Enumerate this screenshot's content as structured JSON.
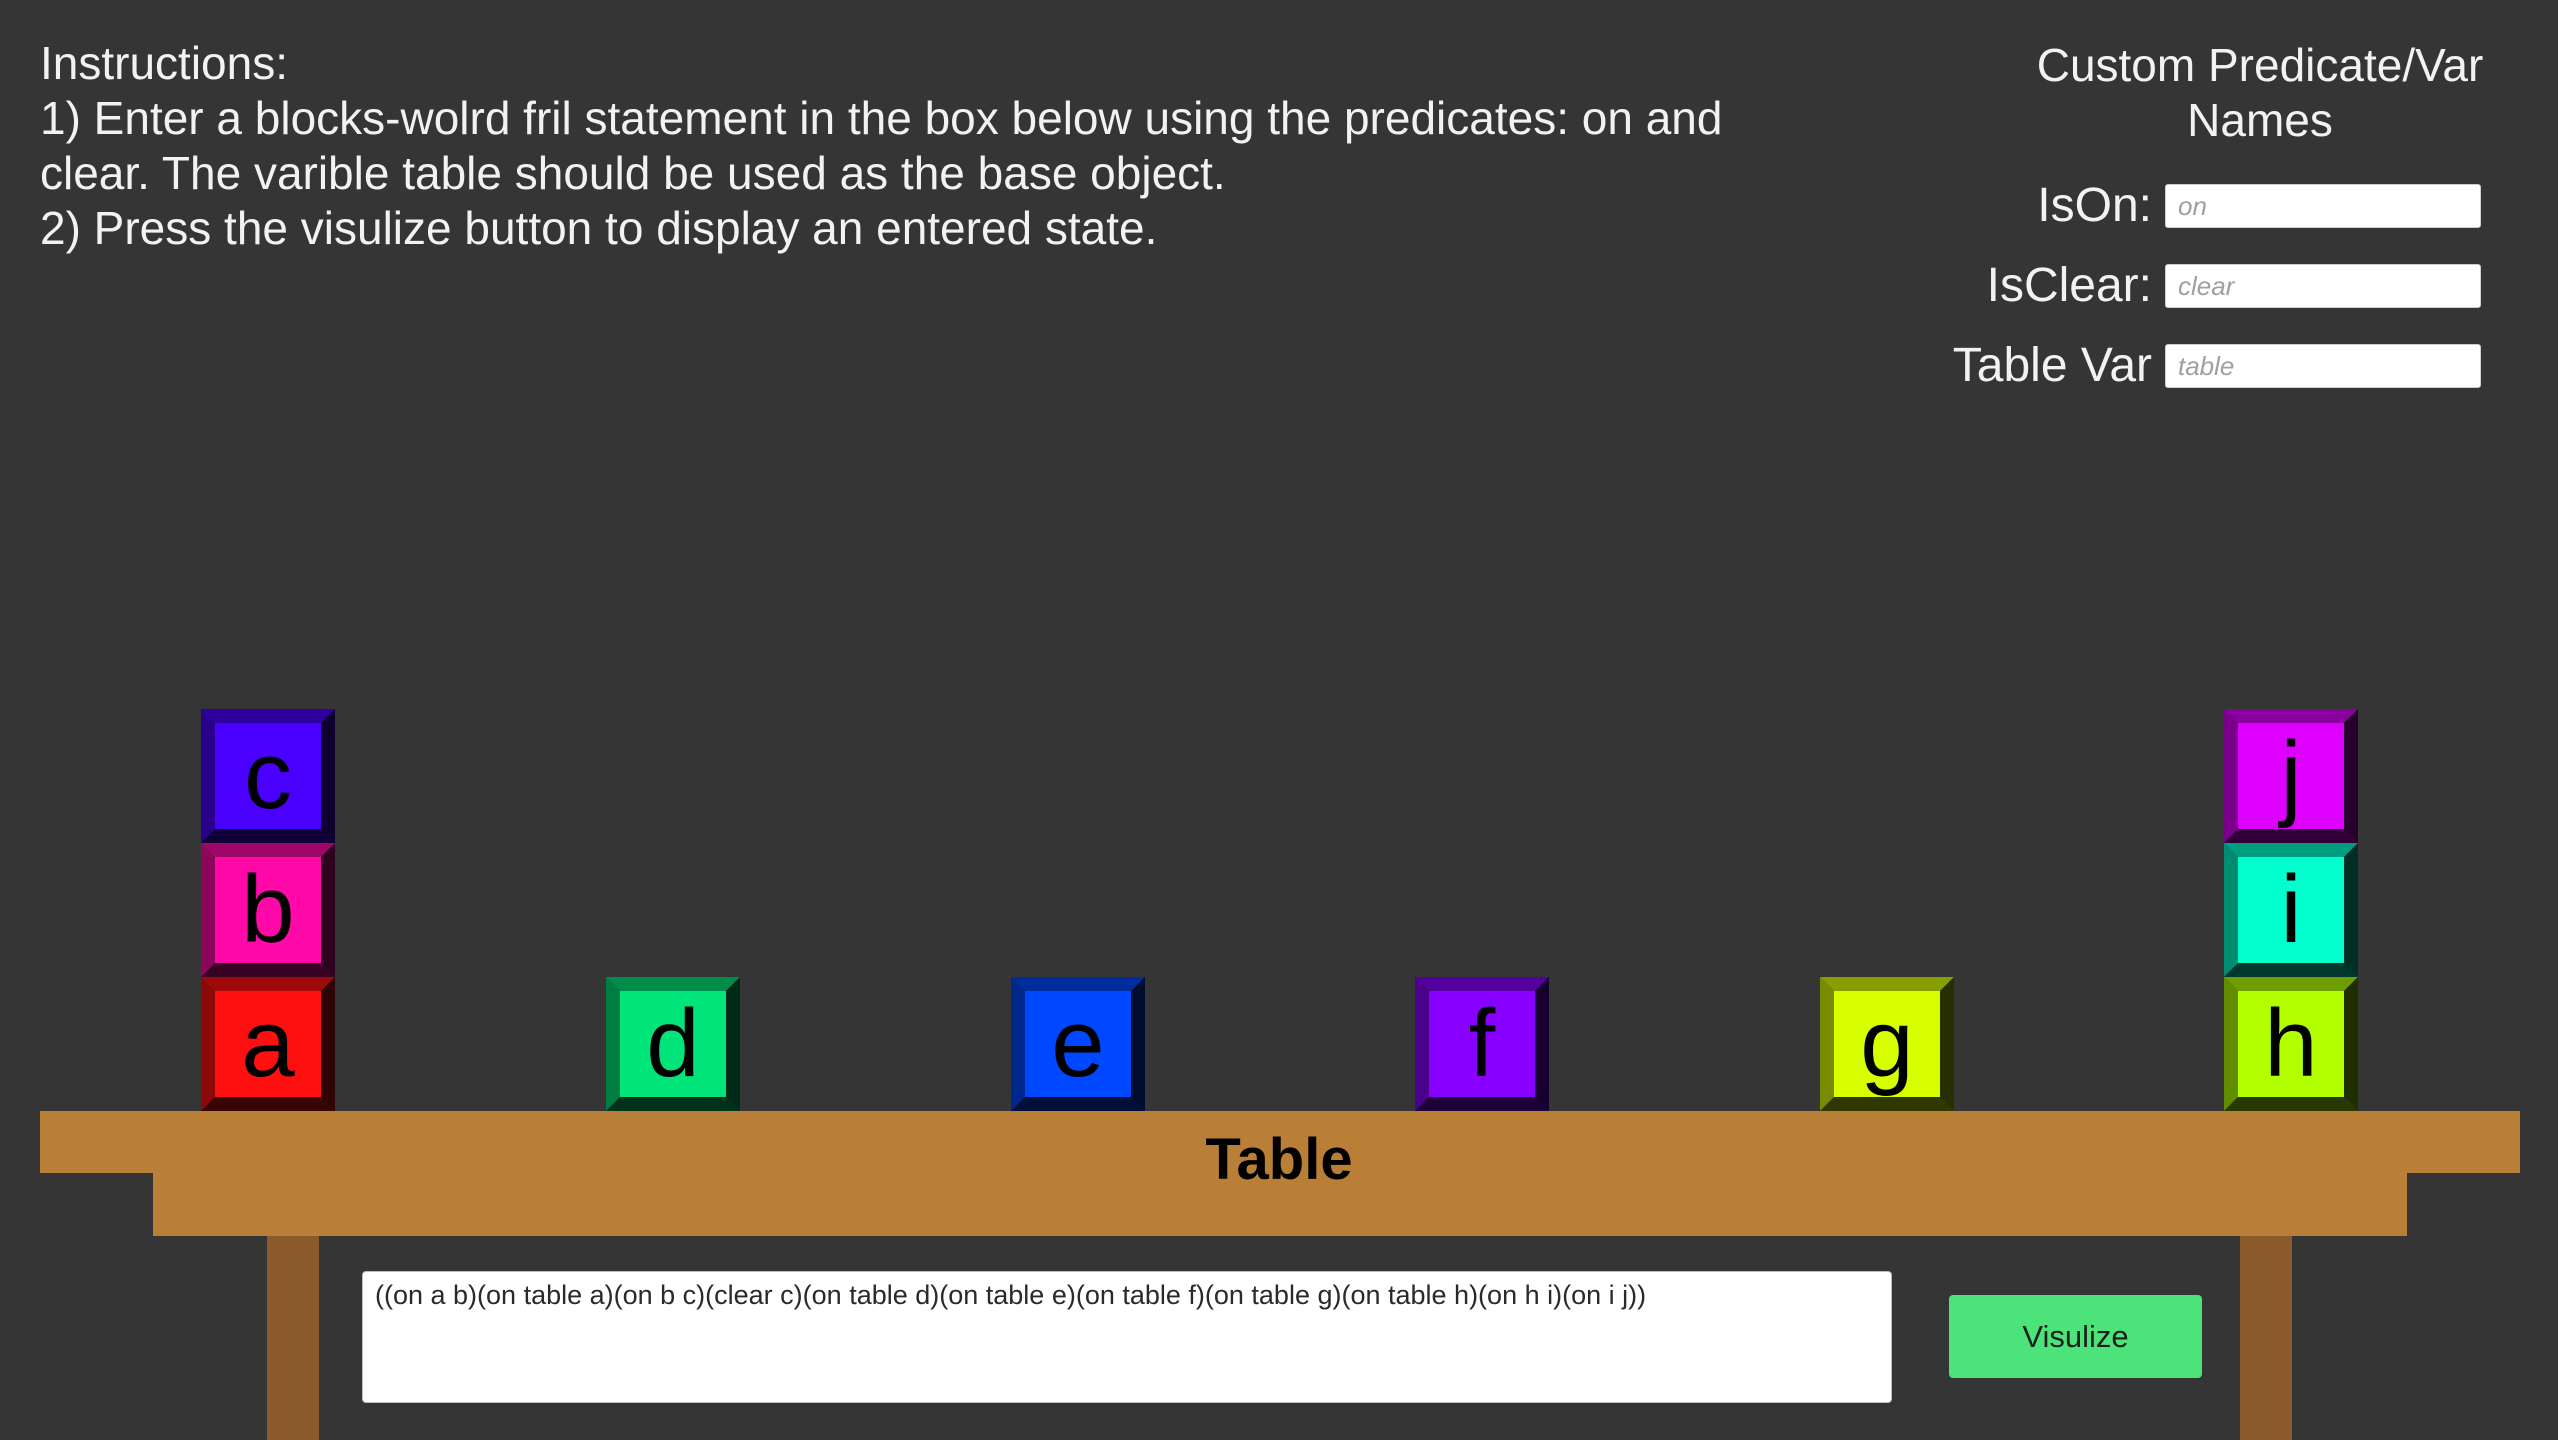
{
  "instructions": {
    "heading": "Instructions:",
    "line1": "1) Enter a blocks-wolrd fril statement in the box below using the predicates: on and clear. The varible table should be used as the base object.",
    "line2": "2) Press the visulize button to display an entered state."
  },
  "custom_names": {
    "title": "Custom Predicate/Var Names",
    "is_on": {
      "label": "IsOn:",
      "placeholder": "on"
    },
    "is_clear": {
      "label": "IsClear:",
      "placeholder": "clear"
    },
    "table_var": {
      "label": "Table Var",
      "placeholder": "table"
    }
  },
  "blocks": [
    {
      "letter": "a",
      "color": "#ff1010"
    },
    {
      "letter": "b",
      "color": "#ff0aa8"
    },
    {
      "letter": "c",
      "color": "#4a00ff"
    },
    {
      "letter": "d",
      "color": "#00e47a"
    },
    {
      "letter": "e",
      "color": "#0048ff"
    },
    {
      "letter": "f",
      "color": "#8800ff"
    },
    {
      "letter": "g",
      "color": "#d8ff00"
    },
    {
      "letter": "h",
      "color": "#b2ff00"
    },
    {
      "letter": "i",
      "color": "#00ffcc"
    },
    {
      "letter": "j",
      "color": "#dd00ff"
    }
  ],
  "table": {
    "label": "Table",
    "color": "#ba7f37",
    "leg_color": "#8b5a2b"
  },
  "statement": {
    "value": "((on a b)(on table a)(on b c)(clear c)(on table d)(on table e)(on table f)(on table g)(on table h)(on h i)(on i j))"
  },
  "visualize_button": {
    "label": "Visulize",
    "color": "#4ce47a"
  }
}
